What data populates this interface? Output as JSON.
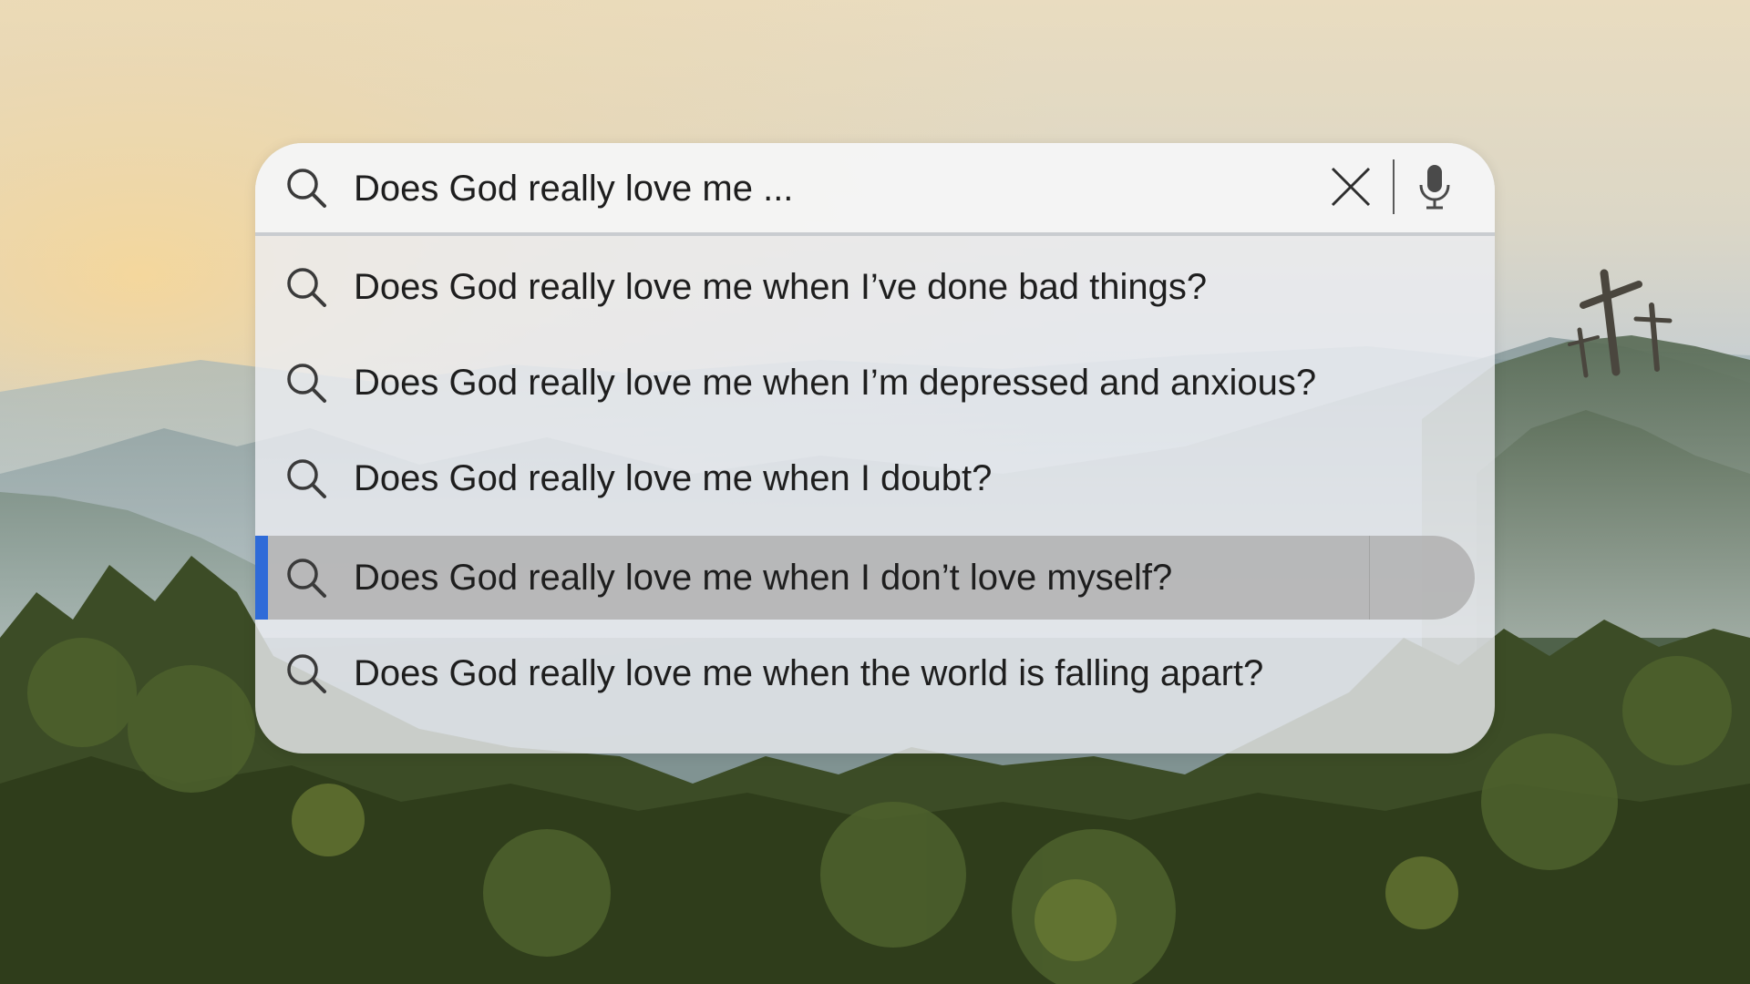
{
  "search": {
    "query": "Does God really love me ...",
    "clear_icon": "close-icon",
    "voice_icon": "microphone-icon"
  },
  "suggestions": [
    {
      "text": "Does God really love me when I’ve done bad things?",
      "icon": "search-icon"
    },
    {
      "text": "Does God really love me when I’m depressed and anxious?",
      "icon": "search-icon"
    },
    {
      "text": "Does God really love me when I doubt?",
      "icon": "search-icon"
    },
    {
      "text": "Does God really love me when I don’t love myself?",
      "icon": "search-icon",
      "highlighted": true
    },
    {
      "text": "Does God really love me when the world is falling apart?",
      "icon": "search-icon"
    }
  ],
  "colors": {
    "highlight_accent": "#2f6bd8",
    "highlight_bg": "#b0b0b0",
    "text": "#1e1e1e"
  }
}
